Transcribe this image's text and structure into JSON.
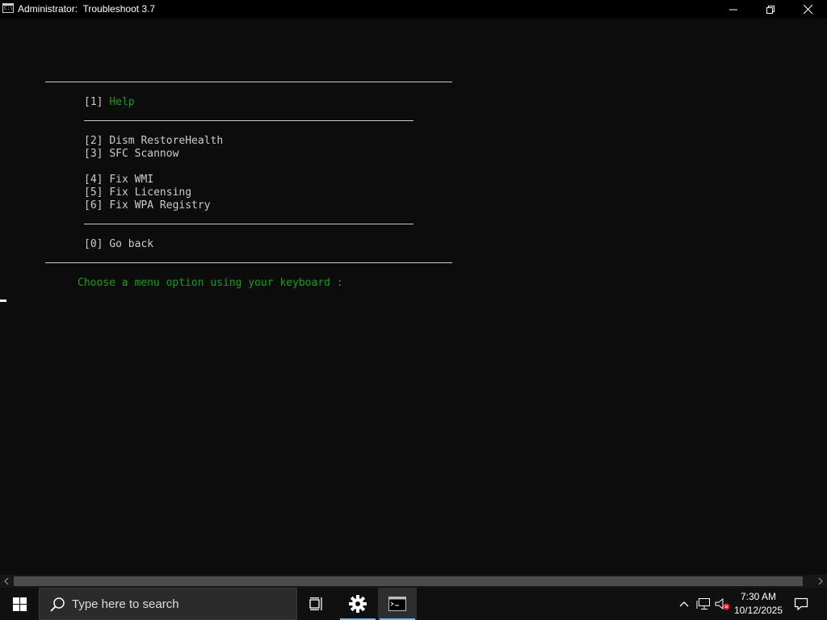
{
  "window": {
    "title": "Administrator:  Troubleshoot 3.7",
    "icon": "cmd-icon",
    "controls": [
      "minimize-icon",
      "restore-icon",
      "close-icon"
    ]
  },
  "console": {
    "menu": [
      {
        "key": "[1]",
        "label": "Help",
        "highlight": true
      },
      {
        "key": "[2]",
        "label": "Dism RestoreHealth"
      },
      {
        "key": "[3]",
        "label": "SFC Scannow"
      },
      {
        "key": "[4]",
        "label": "Fix WMI"
      },
      {
        "key": "[5]",
        "label": "Fix Licensing"
      },
      {
        "key": "[6]",
        "label": "Fix WPA Registry"
      },
      {
        "key": "[0]",
        "label": "Go back"
      }
    ],
    "prompt": "Choose a menu option using your keyboard :"
  },
  "taskbar": {
    "search_placeholder": "Type here to search",
    "time": "7:30 AM",
    "date": "10/12/2025",
    "pinned": [
      "task-view-icon",
      "settings-icon",
      "cmd-icon"
    ],
    "tray": [
      "chevron-up-icon",
      "network-icon",
      "volume-muted-icon",
      "notification-icon"
    ]
  },
  "colors": {
    "console_bg": "#0c0c0c",
    "console_text": "#cccccc",
    "accent_green": "#13a10e",
    "taskbar_bg": "#101010"
  }
}
